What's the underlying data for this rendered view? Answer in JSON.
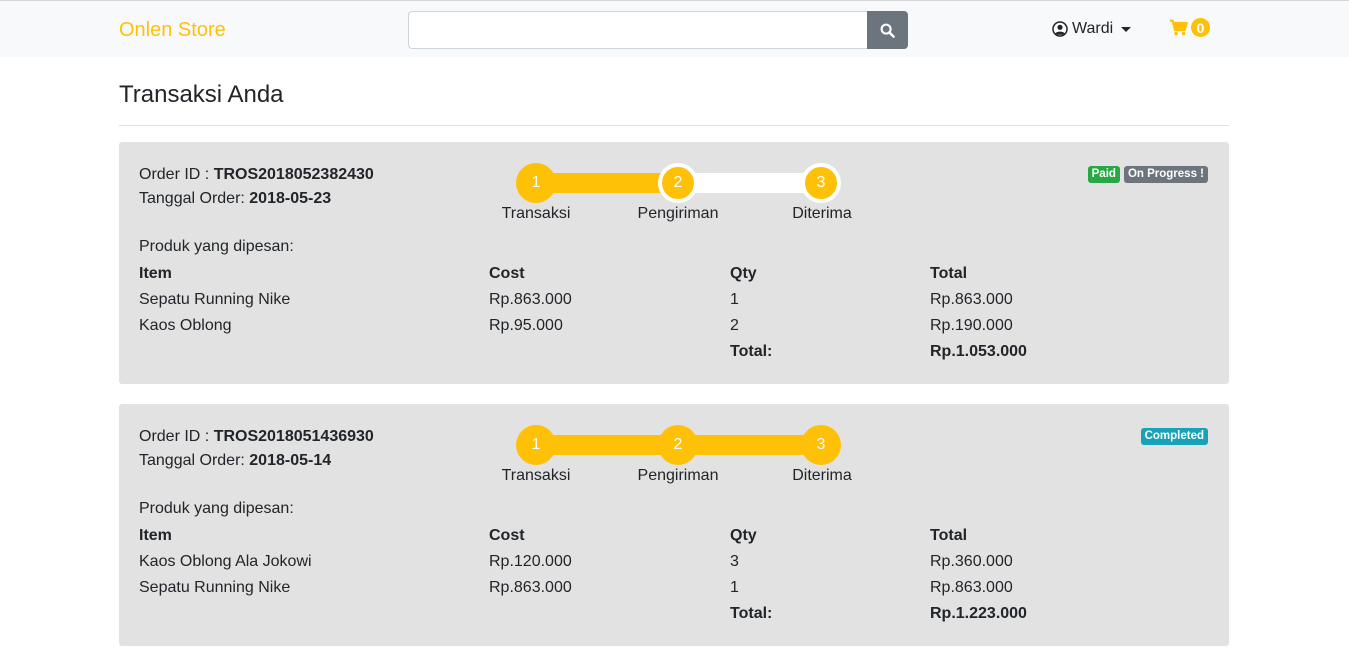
{
  "navbar": {
    "brand": "Onlen Store",
    "search": {
      "value": "",
      "placeholder": "",
      "button_icon": "search-icon"
    },
    "user": {
      "icon": "user-circle-icon",
      "name": "Wardi"
    },
    "cart": {
      "icon": "shopping-cart-icon",
      "count": "0"
    }
  },
  "page": {
    "title": "Transaksi Anda"
  },
  "colors": {
    "brand": "#ffc107",
    "card_bg": "#e2e2e2",
    "paid": "#28a745",
    "progress": "#6c757d",
    "completed": "#17a2b8"
  },
  "orders": [
    {
      "order_id_label": "Order ID : ",
      "order_id": "TROS2018052382430",
      "date_label": "Tanggal Order: ",
      "date": "2018-05-23",
      "steps": [
        {
          "num": "1",
          "label": "Transaksi"
        },
        {
          "num": "2",
          "label": "Pengiriman"
        },
        {
          "num": "3",
          "label": "Diterima"
        }
      ],
      "progress_fraction": 0.5,
      "badges": [
        {
          "text": "Paid",
          "color": "#28a745"
        },
        {
          "text": "On Progress !",
          "color": "#6c757d"
        }
      ],
      "products_label": "Produk yang dipesan:",
      "columns": [
        "Item",
        "Cost",
        "Qty",
        "Total"
      ],
      "items": [
        {
          "item": "Sepatu Running Nike",
          "cost": "Rp.863.000",
          "qty": "1",
          "total": "Rp.863.000"
        },
        {
          "item": "Kaos Oblong",
          "cost": "Rp.95.000",
          "qty": "2",
          "total": "Rp.190.000"
        }
      ],
      "total_label": "Total:",
      "grand_total": "Rp.1.053.000"
    },
    {
      "order_id_label": "Order ID : ",
      "order_id": "TROS2018051436930",
      "date_label": "Tanggal Order: ",
      "date": "2018-05-14",
      "steps": [
        {
          "num": "1",
          "label": "Transaksi"
        },
        {
          "num": "2",
          "label": "Pengiriman"
        },
        {
          "num": "3",
          "label": "Diterima"
        }
      ],
      "progress_fraction": 1.0,
      "badges": [
        {
          "text": "Completed",
          "color": "#17a2b8"
        }
      ],
      "products_label": "Produk yang dipesan:",
      "columns": [
        "Item",
        "Cost",
        "Qty",
        "Total"
      ],
      "items": [
        {
          "item": "Kaos Oblong Ala Jokowi",
          "cost": "Rp.120.000",
          "qty": "3",
          "total": "Rp.360.000"
        },
        {
          "item": "Sepatu Running Nike",
          "cost": "Rp.863.000",
          "qty": "1",
          "total": "Rp.863.000"
        }
      ],
      "total_label": "Total:",
      "grand_total": "Rp.1.223.000"
    }
  ]
}
